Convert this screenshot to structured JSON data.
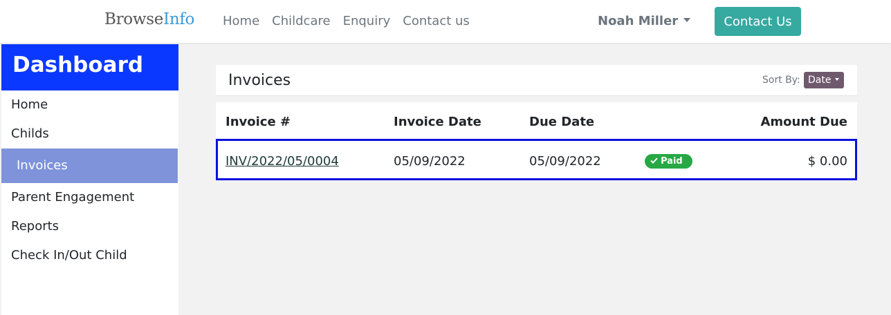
{
  "navbar": {
    "brand_part1": "Browse",
    "brand_part2": "Info",
    "links": [
      "Home",
      "Childcare",
      "Enquiry",
      "Contact us"
    ],
    "user_name": "Noah Miller",
    "contact_button": "Contact Us"
  },
  "sidebar": {
    "title": "Dashboard",
    "items": [
      {
        "label": "Home"
      },
      {
        "label": "Childs"
      },
      {
        "label": "Invoices"
      },
      {
        "label": "Parent Engagement"
      },
      {
        "label": "Reports"
      },
      {
        "label": "Check In/Out Child"
      }
    ],
    "active_item": "Invoices"
  },
  "invoices": {
    "title": "Invoices",
    "sort_label": "Sort By:",
    "sort_value": "Date",
    "columns": [
      "Invoice #",
      "Invoice Date",
      "Due Date",
      "Amount Due"
    ],
    "rows": [
      {
        "invoice_no": "INV/2022/05/0004",
        "invoice_date": "05/09/2022",
        "due_date": "05/09/2022",
        "status": "Paid",
        "amount_due": "$ 0.00"
      }
    ]
  },
  "colors": {
    "sidebar_header": "#0b38ff",
    "sidebar_active": "#7f93db",
    "contact_button": "#36a9a1",
    "paid_badge": "#27a844",
    "highlight_border": "#0a10e0",
    "sort_button": "#6f5a6d"
  },
  "icons": {
    "caret": "chevron-down-icon",
    "paid": "check-icon"
  }
}
